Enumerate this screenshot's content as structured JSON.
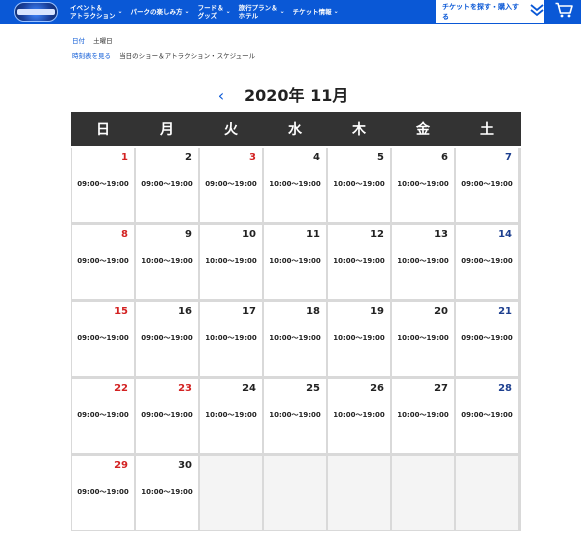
{
  "header": {
    "nav": [
      {
        "label": "イベント＆\nアトラクション"
      },
      {
        "label": "パークの楽しみ方"
      },
      {
        "label": "フード＆\nグッズ"
      },
      {
        "label": "旅行プラン＆\nホテル"
      },
      {
        "label": "チケット情報"
      }
    ],
    "ticket_cta": "チケットを探す・購入する"
  },
  "info": {
    "date_label": "日付",
    "date_value": "土曜日",
    "schedule_label": "時刻表を見る",
    "schedule_value": "当日のショー＆アトラクション・スケジュール"
  },
  "calendar": {
    "month_title": "2020年 11月",
    "prev_symbol": "‹",
    "weekdays": [
      "日",
      "月",
      "火",
      "水",
      "木",
      "金",
      "土"
    ],
    "weeks": [
      [
        {
          "day": "1",
          "hours": "09:00～19:00",
          "kind": "sun"
        },
        {
          "day": "2",
          "hours": "09:00～19:00",
          "kind": "wk"
        },
        {
          "day": "3",
          "hours": "09:00～19:00",
          "kind": "sun"
        },
        {
          "day": "4",
          "hours": "10:00～19:00",
          "kind": "wk"
        },
        {
          "day": "5",
          "hours": "10:00～19:00",
          "kind": "wk"
        },
        {
          "day": "6",
          "hours": "10:00～19:00",
          "kind": "wk"
        },
        {
          "day": "7",
          "hours": "09:00～19:00",
          "kind": "sat"
        }
      ],
      [
        {
          "day": "8",
          "hours": "09:00～19:00",
          "kind": "sun"
        },
        {
          "day": "9",
          "hours": "10:00～19:00",
          "kind": "wk"
        },
        {
          "day": "10",
          "hours": "10:00～19:00",
          "kind": "wk"
        },
        {
          "day": "11",
          "hours": "10:00～19:00",
          "kind": "wk"
        },
        {
          "day": "12",
          "hours": "10:00～19:00",
          "kind": "wk"
        },
        {
          "day": "13",
          "hours": "10:00～19:00",
          "kind": "wk"
        },
        {
          "day": "14",
          "hours": "09:00～19:00",
          "kind": "sat"
        }
      ],
      [
        {
          "day": "15",
          "hours": "09:00～19:00",
          "kind": "sun"
        },
        {
          "day": "16",
          "hours": "09:00～19:00",
          "kind": "wk"
        },
        {
          "day": "17",
          "hours": "10:00～19:00",
          "kind": "wk"
        },
        {
          "day": "18",
          "hours": "10:00～19:00",
          "kind": "wk"
        },
        {
          "day": "19",
          "hours": "10:00～19:00",
          "kind": "wk"
        },
        {
          "day": "20",
          "hours": "10:00～19:00",
          "kind": "wk"
        },
        {
          "day": "21",
          "hours": "09:00～19:00",
          "kind": "sat"
        }
      ],
      [
        {
          "day": "22",
          "hours": "09:00～19:00",
          "kind": "sun"
        },
        {
          "day": "23",
          "hours": "09:00～19:00",
          "kind": "sun"
        },
        {
          "day": "24",
          "hours": "10:00～19:00",
          "kind": "wk"
        },
        {
          "day": "25",
          "hours": "10:00～19:00",
          "kind": "wk"
        },
        {
          "day": "26",
          "hours": "10:00～19:00",
          "kind": "wk"
        },
        {
          "day": "27",
          "hours": "10:00～19:00",
          "kind": "wk"
        },
        {
          "day": "28",
          "hours": "09:00～19:00",
          "kind": "sat"
        }
      ],
      [
        {
          "day": "29",
          "hours": "09:00～19:00",
          "kind": "sun"
        },
        {
          "day": "30",
          "hours": "10:00～19:00",
          "kind": "wk"
        },
        null,
        null,
        null,
        null,
        null
      ]
    ]
  },
  "colors": {
    "brand_blue": "#0a58d6",
    "header_dark": "#333333",
    "holiday_red": "#d32222",
    "saturday_navy": "#1d3f8f"
  },
  "icons": {
    "logo": "park-logo-globe",
    "nav_caret": "chevron-down-icon",
    "ticket": "double-chevron-down-icon",
    "cart": "cart-icon",
    "prev": "chevron-left-icon"
  }
}
